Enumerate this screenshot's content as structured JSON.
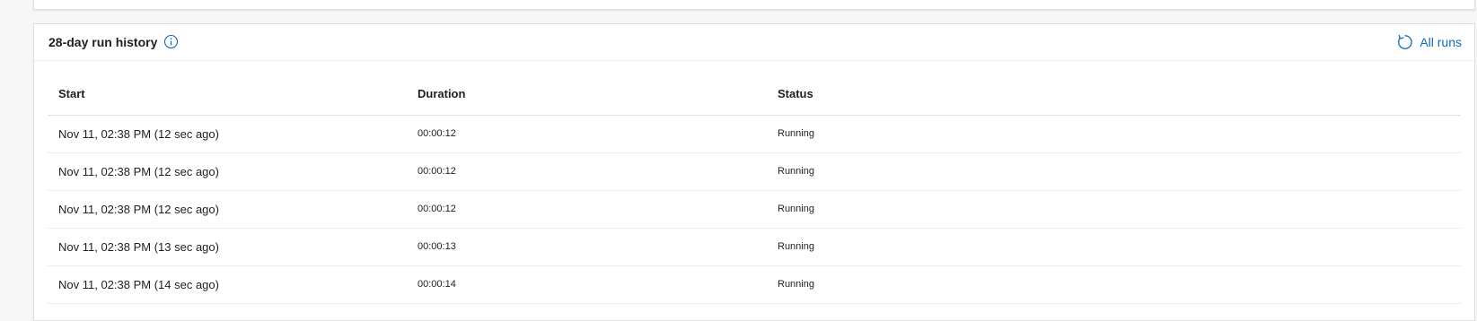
{
  "card": {
    "title": "28-day run history",
    "info_icon": "info-icon",
    "all_runs_icon": "refresh-icon",
    "all_runs_label": "All runs"
  },
  "table": {
    "columns": [
      "Start",
      "Duration",
      "Status"
    ],
    "rows": [
      {
        "start": "Nov 11, 02:38 PM (12 sec ago)",
        "duration": "00:00:12",
        "status": "Running"
      },
      {
        "start": "Nov 11, 02:38 PM (12 sec ago)",
        "duration": "00:00:12",
        "status": "Running"
      },
      {
        "start": "Nov 11, 02:38 PM (12 sec ago)",
        "duration": "00:00:12",
        "status": "Running"
      },
      {
        "start": "Nov 11, 02:38 PM (13 sec ago)",
        "duration": "00:00:13",
        "status": "Running"
      },
      {
        "start": "Nov 11, 02:38 PM (14 sec ago)",
        "duration": "00:00:14",
        "status": "Running"
      }
    ]
  },
  "colors": {
    "accent": "#0f6cbd",
    "background": "#f6f6f6",
    "card": "#ffffff",
    "border": "#e1dfdd"
  }
}
